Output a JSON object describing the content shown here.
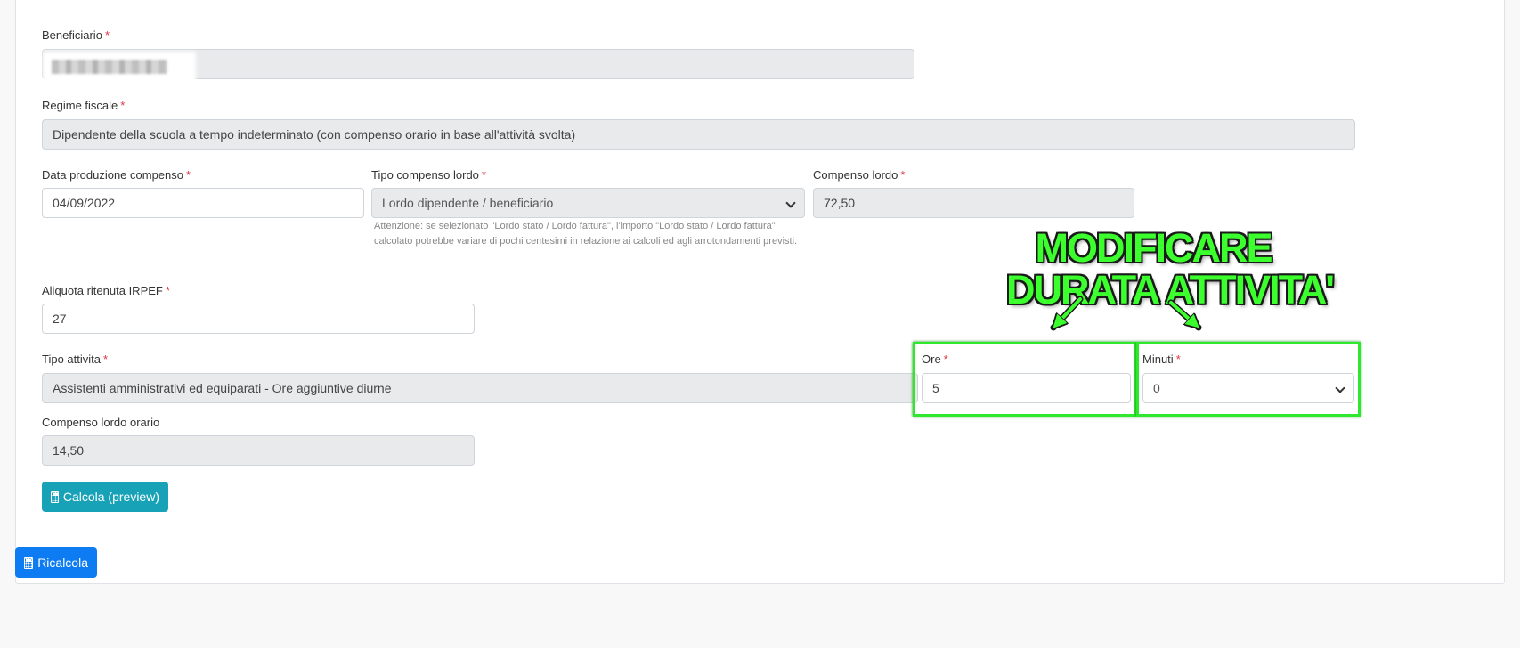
{
  "form": {
    "beneficiario": {
      "label": "Beneficiario",
      "required": "*"
    },
    "regime_fiscale": {
      "label": "Regime fiscale",
      "required": "*",
      "value": "Dipendente della scuola a tempo indeterminato (con compenso orario in base all'attività svolta)"
    },
    "data_produzione": {
      "label": "Data produzione compenso",
      "required": "*",
      "value": "04/09/2022"
    },
    "tipo_compenso": {
      "label": "Tipo compenso lordo",
      "required": "*",
      "value": "Lordo dipendente / beneficiario",
      "help": "Attenzione: se selezionato \"Lordo stato / Lordo fattura\", l'importo \"Lordo stato / Lordo fattura\" calcolato potrebbe variare di pochi centesimi in relazione ai calcoli ed agli arrotondamenti previsti."
    },
    "compenso_lordo": {
      "label": "Compenso lordo",
      "required": "*",
      "value": "72,50"
    },
    "aliquota_irpef": {
      "label": "Aliquota ritenuta IRPEF",
      "required": "*",
      "value": "27"
    },
    "tipo_attivita": {
      "label": "Tipo attivita",
      "required": "*",
      "value": "Assistenti amministrativi ed equiparati - Ore aggiuntive diurne"
    },
    "ore": {
      "label": "Ore",
      "required": "*",
      "value": "5"
    },
    "minuti": {
      "label": "Minuti",
      "required": "*",
      "value": "0"
    },
    "compenso_orario": {
      "label": "Compenso lordo orario",
      "value": "14,50"
    },
    "calcola_button": "Calcola (preview)"
  },
  "ricalcola_button": "Ricalcola",
  "annotation": {
    "line1": "MODIFICARE",
    "line2": "DURATA ATTIVITA'",
    "color": "#3cff2e"
  },
  "colors": {
    "required": "#dc3545",
    "teal_button": "#17a2b8",
    "blue_button": "#0d7cf2",
    "highlight": "#2ee82e"
  }
}
